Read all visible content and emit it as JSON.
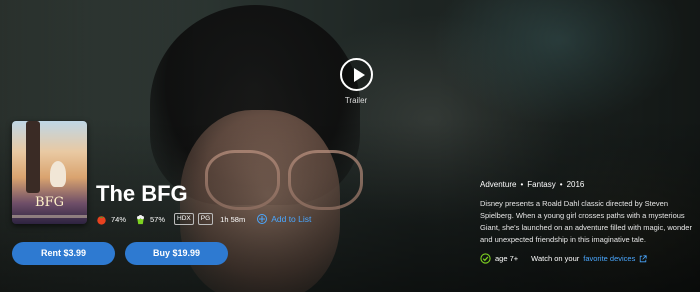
{
  "trailer": {
    "label": "Trailer"
  },
  "poster": {
    "title": "BFG"
  },
  "movie": {
    "title": "The BFG",
    "tomatometer": "74%",
    "audience_score": "57%",
    "quality_badge": "HDX",
    "rating_badge": "PG",
    "runtime": "1h 58m",
    "add_to_list": "Add to List"
  },
  "actions": {
    "rent": "Rent $3.99",
    "buy": "Buy $19.99"
  },
  "details": {
    "genre1": "Adventure",
    "genre2": "Fantasy",
    "year": "2016",
    "separator": "•",
    "description": "Disney presents a Roald Dahl classic directed by Steven Spielberg. When a young girl crosses paths with a mysterious Giant, she's launched on an adventure filled with magic, wonder and unexpected friendship in this imaginative tale.",
    "age": "age 7+",
    "watch_on": "Watch on your",
    "favorite_devices": "favorite devices"
  },
  "colors": {
    "accent": "#2e7ad1",
    "link": "#4aa7ff",
    "tomato": "#e8421f",
    "popcorn": "#7ed321"
  }
}
